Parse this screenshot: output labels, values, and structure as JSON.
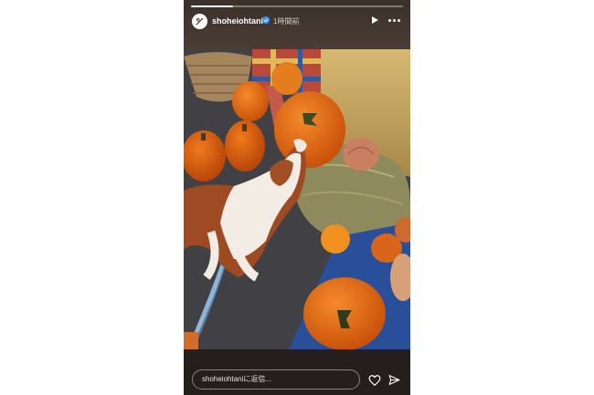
{
  "story": {
    "username": "shoheiohtani",
    "time_ago": "1時間前",
    "progress": 0.2,
    "reply_placeholder": "shoheiohtaniに返信..."
  },
  "icons": {
    "avatar": "avatar-logo-icon",
    "verified": "verified-badge-icon",
    "play": "play-icon",
    "more": "more-options-icon",
    "heart": "heart-icon",
    "send": "send-icon"
  },
  "photo": {
    "description_colors": {
      "pumpkin": "#e06a10",
      "hay": "#c9a85c",
      "asphalt": "#3c3b3e",
      "blue_mat": "#2a4f9a"
    }
  }
}
